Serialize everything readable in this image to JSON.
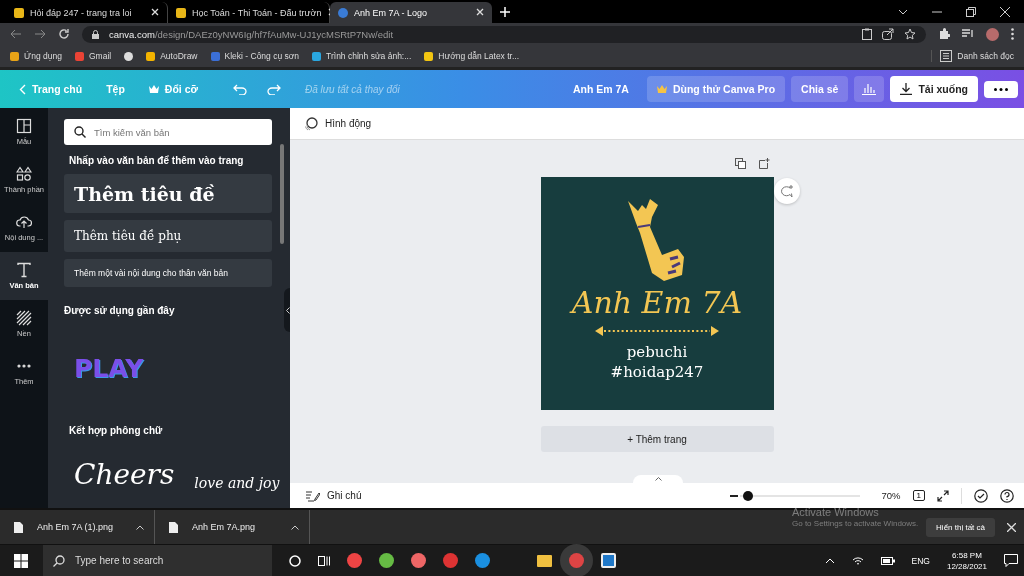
{
  "browser": {
    "tabs": [
      {
        "title": "Hỏi đáp 247 - trang tra loi",
        "selected": false
      },
      {
        "title": "Học Toán - Thi Toán - Đấu trườn",
        "selected": false
      },
      {
        "title": "Anh Em 7A - Logo",
        "selected": true
      }
    ],
    "url_host": "canva.com",
    "url_path": "/design/DAEz0yNW6Ig/hf7fAuMw-UJ1ycMSRtP7Nw/edit",
    "bookmarks": [
      {
        "label": "Ứng dụng",
        "kind": "apps"
      },
      {
        "label": "Gmail",
        "kind": "gmail"
      },
      {
        "kind": "globe"
      },
      {
        "label": "AutoDraw",
        "kind": "autodraw"
      },
      {
        "label": "Kleki - Công cụ sơn",
        "kind": "kleki"
      },
      {
        "label": "Trình chỉnh sửa ảnh:...",
        "kind": "photo"
      },
      {
        "label": "Hướng dẫn Latex tr...",
        "kind": "h"
      }
    ],
    "reading_list": "Danh sách đọc"
  },
  "toolbar": {
    "home": "Trang chủ",
    "file": "Tệp",
    "resize": "Đổi cỡ",
    "status": "Đã lưu tất cả thay đổi",
    "design_title": "Anh Em 7A",
    "pro": "Dùng thử Canva Pro",
    "share": "Chia sẻ",
    "download": "Tải xuống"
  },
  "rail": [
    {
      "label": "Mẫu",
      "kind": "templates",
      "selected": false
    },
    {
      "label": "Thành phần",
      "kind": "elements",
      "selected": false
    },
    {
      "label": "Nội dung ...",
      "kind": "uploads",
      "selected": false
    },
    {
      "label": "Văn bản",
      "kind": "text",
      "selected": true
    },
    {
      "label": "Nền",
      "kind": "background",
      "selected": false
    },
    {
      "label": "Thêm",
      "kind": "more",
      "selected": false
    }
  ],
  "panel": {
    "search_placeholder": "Tìm kiếm văn bản",
    "heading": "Nhấp vào văn bản để thêm vào trang",
    "presets": [
      {
        "kind": "heading",
        "label": "Thêm tiêu đề"
      },
      {
        "kind": "subheading",
        "label": "Thêm tiêu đề phụ"
      },
      {
        "kind": "body",
        "label": "Thêm một vài nội dung cho thân văn bản"
      }
    ],
    "recent_heading": "Được sử dụng gần đây",
    "recent_sample": "PLAY",
    "combos_heading": "Kết hợp phông chữ",
    "combo_samples": [
      "Cheers",
      "love and joy"
    ]
  },
  "canvas": {
    "animate": "Hình động",
    "design": {
      "title": "Anh Em 7A",
      "lines": [
        "pebuchi",
        "#hoidap247"
      ]
    },
    "add_page": "+ Thêm trang"
  },
  "bottom_bar": {
    "notes": "Ghi chú",
    "zoom": {
      "level": 0.07
    },
    "zoom_reading": "70%",
    "page_count": "1"
  },
  "activation": {
    "title": "Activate Windows",
    "hint": "Go to Settings to activate Windows."
  },
  "downloads": {
    "files": [
      "Anh Em 7A (1).png",
      "Anh Em 7A.png"
    ],
    "show_all": "Hiển thị tất cả"
  },
  "taskbar": {
    "search_placeholder": "Type here to search",
    "language": "ENG",
    "time": "6:58 PM",
    "date": "12/28/2021"
  }
}
